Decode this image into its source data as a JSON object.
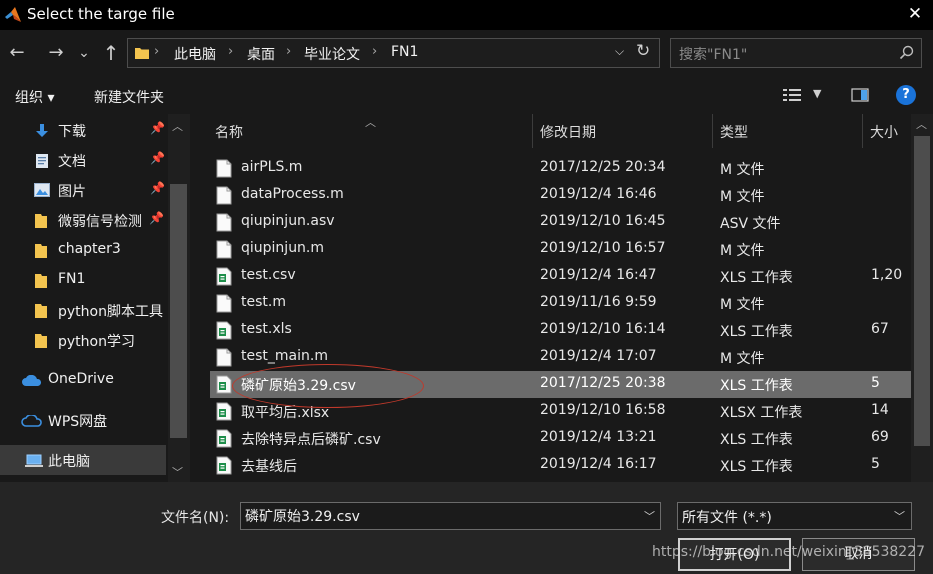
{
  "window": {
    "title": "Select the targe file",
    "close_glyph": "✕"
  },
  "nav": {
    "back": "←",
    "forward": "→",
    "recent": "⌄",
    "up": "↑",
    "breadcrumb": [
      "此电脑",
      "桌面",
      "毕业论文",
      "FN1"
    ],
    "separator": "›",
    "search_placeholder": "搜索\"FN1\""
  },
  "toolbar": {
    "organize": "组织 ▾",
    "new_folder": "新建文件夹"
  },
  "sidebar": {
    "items": [
      {
        "label": "下载",
        "icon": "download-icon",
        "pinned": true
      },
      {
        "label": "文档",
        "icon": "document-icon",
        "pinned": true
      },
      {
        "label": "图片",
        "icon": "picture-icon",
        "pinned": true
      },
      {
        "label": "微弱信号检测",
        "icon": "folder-icon",
        "pinned": true
      },
      {
        "label": "chapter3",
        "icon": "folder-icon",
        "pinned": false
      },
      {
        "label": "FN1",
        "icon": "folder-icon",
        "pinned": false
      },
      {
        "label": "python脚本工具",
        "icon": "folder-icon",
        "pinned": false
      },
      {
        "label": "python学习",
        "icon": "folder-icon",
        "pinned": false
      },
      {
        "label": "OneDrive",
        "icon": "cloud-icon",
        "pinned": false
      },
      {
        "label": "WPS网盘",
        "icon": "cloud-icon",
        "pinned": false
      },
      {
        "label": "此电脑",
        "icon": "computer-icon",
        "pinned": false
      }
    ],
    "pin_glyph": "📌"
  },
  "columns": {
    "name": "名称",
    "date": "修改日期",
    "type": "类型",
    "size": "大小"
  },
  "files": [
    {
      "name": "airPLS.m",
      "date": "2017/12/25 20:34",
      "type": "M 文件",
      "size": "",
      "icon": "doc-file-icon"
    },
    {
      "name": "dataProcess.m",
      "date": "2019/12/4 16:46",
      "type": "M 文件",
      "size": "",
      "icon": "doc-file-icon"
    },
    {
      "name": "qiupinjun.asv",
      "date": "2019/12/10 16:45",
      "type": "ASV 文件",
      "size": "",
      "icon": "doc-file-icon"
    },
    {
      "name": "qiupinjun.m",
      "date": "2019/12/10 16:57",
      "type": "M 文件",
      "size": "",
      "icon": "doc-file-icon"
    },
    {
      "name": "test.csv",
      "date": "2019/12/4 16:47",
      "type": "XLS 工作表",
      "size": "1,20",
      "icon": "spreadsheet-file-icon"
    },
    {
      "name": "test.m",
      "date": "2019/11/16 9:59",
      "type": "M 文件",
      "size": "",
      "icon": "doc-file-icon"
    },
    {
      "name": "test.xls",
      "date": "2019/12/10 16:14",
      "type": "XLS 工作表",
      "size": "67",
      "icon": "spreadsheet-file-icon"
    },
    {
      "name": "test_main.m",
      "date": "2019/12/4 17:07",
      "type": "M 文件",
      "size": "",
      "icon": "doc-file-icon"
    },
    {
      "name": "磷矿原始3.29.csv",
      "date": "2017/12/25 20:38",
      "type": "XLS 工作表",
      "size": "5",
      "icon": "spreadsheet-file-icon",
      "selected": true
    },
    {
      "name": "取平均后.xlsx",
      "date": "2019/12/10 16:58",
      "type": "XLSX 工作表",
      "size": "14",
      "icon": "spreadsheet-file-icon"
    },
    {
      "name": "去除特异点后磷矿.csv",
      "date": "2019/12/4 13:21",
      "type": "XLS 工作表",
      "size": "69",
      "icon": "spreadsheet-file-icon"
    },
    {
      "name": "去基线后",
      "date": "2019/12/4 16:17",
      "type": "XLS 工作表",
      "size": "5",
      "icon": "spreadsheet-file-icon"
    }
  ],
  "bottom": {
    "filename_label": "文件名(N):",
    "filename_value": "磷矿原始3.29.csv",
    "filter_value": "所有文件 (*.*)",
    "open_button": "打开(O)",
    "cancel_button": "取消",
    "watermark": "https://blog.csdn.net/weixin_38538227"
  },
  "colors": {
    "accent": "#1a73d9",
    "selection": "#6b6b6b",
    "annotation": "#c0392b",
    "folder": "#f3c44f"
  }
}
